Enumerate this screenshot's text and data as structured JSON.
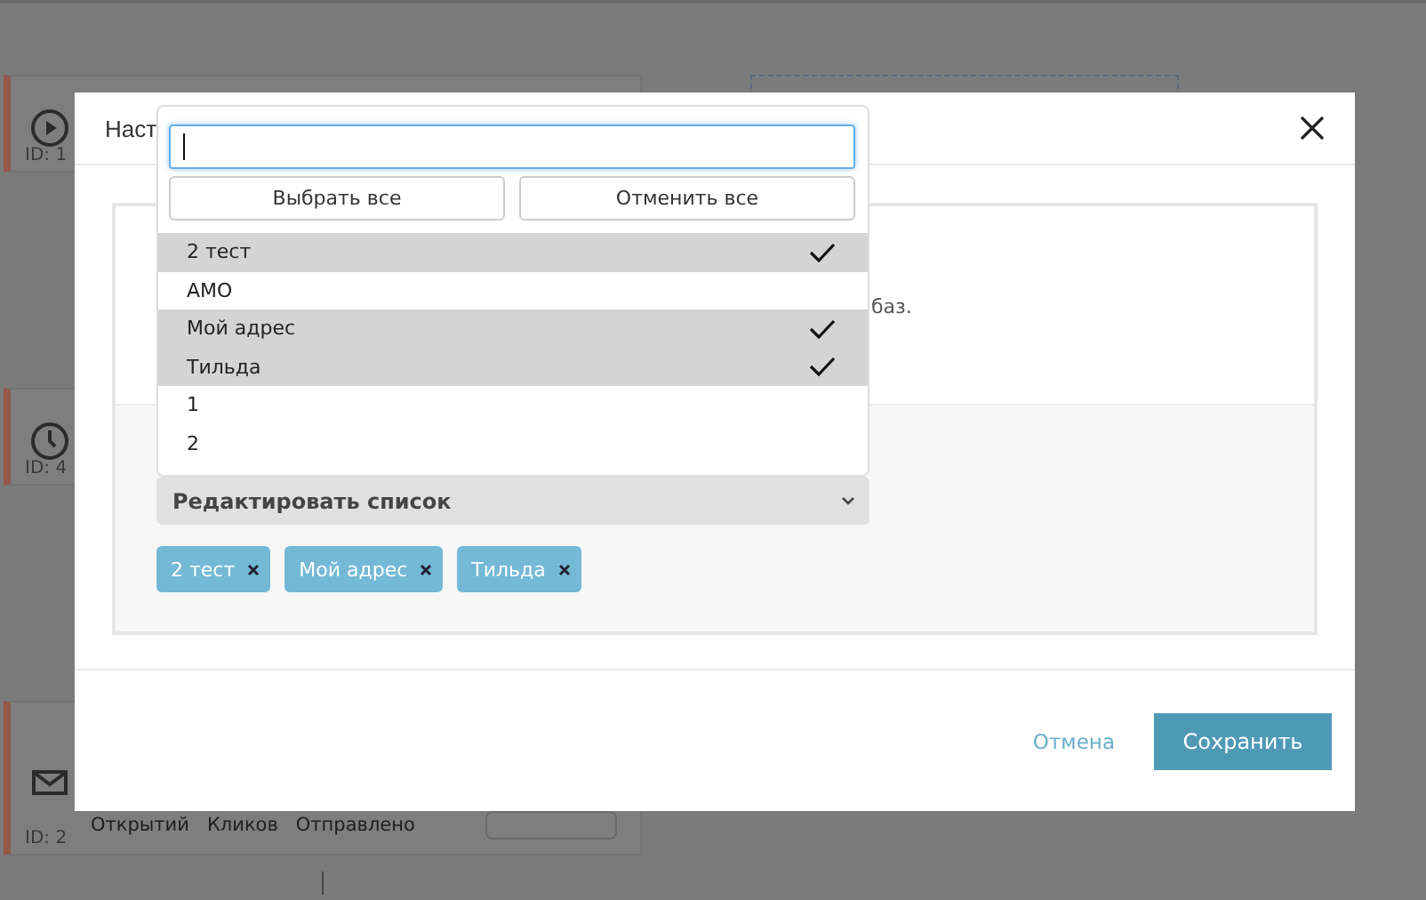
{
  "background": {
    "cards": [
      {
        "kind": "play",
        "id_label": "ID: 1"
      },
      {
        "kind": "clock",
        "id_label": "ID: 4"
      },
      {
        "kind": "mail",
        "id_label": "ID: 2",
        "stats": "Открытий   Кликов   Отправлено"
      }
    ]
  },
  "dialog": {
    "title": "Наст",
    "body_text": "баз.",
    "dropdown": {
      "buttons": [
        "Выбрать все",
        "Отменить все"
      ],
      "options": [
        {
          "label": "2 тест",
          "selected": true
        },
        {
          "label": "АМО",
          "selected": false
        },
        {
          "label": "Мой адрес",
          "selected": true
        },
        {
          "label": "Тильда",
          "selected": true
        },
        {
          "label": "1",
          "selected": false
        },
        {
          "label": "2",
          "selected": false
        }
      ]
    },
    "select": {
      "label": "Редактировать список"
    },
    "tags": [
      "2 тест",
      "Мой адрес",
      "Тильда"
    ],
    "footer": {
      "cancel": "Отмена",
      "save": "Сохранить"
    }
  }
}
